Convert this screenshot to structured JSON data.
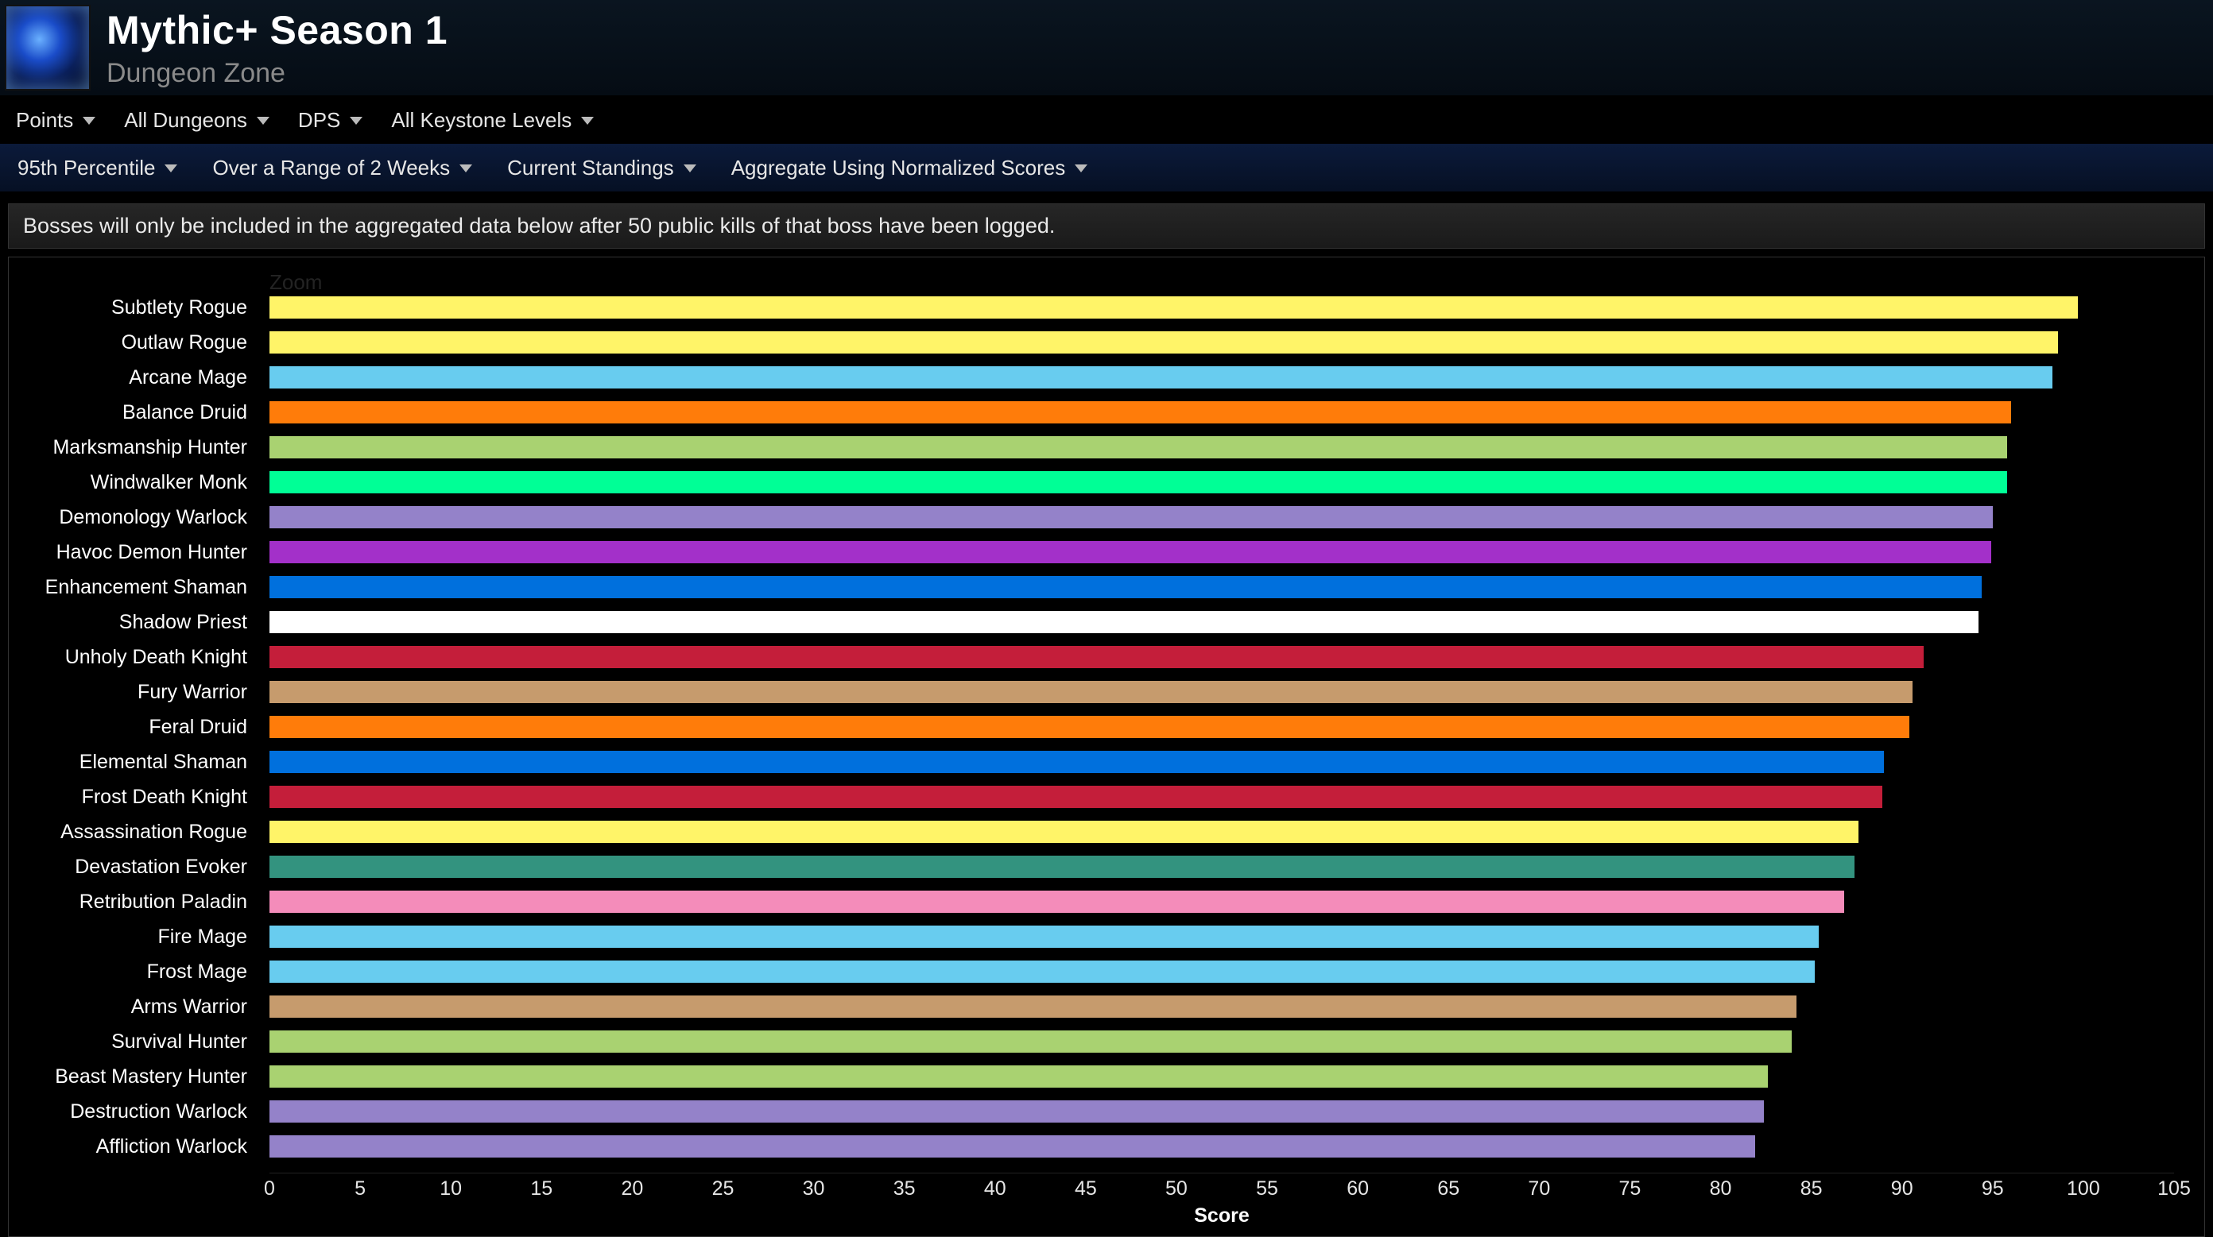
{
  "header": {
    "title": "Mythic+ Season 1",
    "subtitle": "Dungeon Zone"
  },
  "toolbar_primary": [
    {
      "label": "Points"
    },
    {
      "label": "All Dungeons"
    },
    {
      "label": "DPS"
    },
    {
      "label": "All Keystone Levels"
    }
  ],
  "toolbar_secondary": [
    {
      "label": "95th Percentile"
    },
    {
      "label": "Over a Range of 2 Weeks"
    },
    {
      "label": "Current Standings"
    },
    {
      "label": "Aggregate Using Normalized Scores"
    }
  ],
  "note": "Bosses will only be included in the aggregated data below after 50 public kills of that boss have been logged.",
  "chart_ui": {
    "zoom_label": "Zoom"
  },
  "chart_data": {
    "type": "bar",
    "orientation": "horizontal",
    "title": "",
    "xlabel": "Score",
    "ylabel": "",
    "xlim": [
      0,
      105
    ],
    "xticks": [
      0,
      5,
      10,
      15,
      20,
      25,
      30,
      35,
      40,
      45,
      50,
      55,
      60,
      65,
      70,
      75,
      80,
      85,
      90,
      95,
      100,
      105
    ],
    "series": [
      {
        "name": "Subtlety Rogue",
        "value": 99.7,
        "color": "#FFF468"
      },
      {
        "name": "Outlaw Rogue",
        "value": 98.6,
        "color": "#FFF468"
      },
      {
        "name": "Arcane Mage",
        "value": 98.3,
        "color": "#68CCEF"
      },
      {
        "name": "Balance Druid",
        "value": 96.0,
        "color": "#FF7C0A"
      },
      {
        "name": "Marksmanship Hunter",
        "value": 95.8,
        "color": "#A9D271"
      },
      {
        "name": "Windwalker Monk",
        "value": 95.8,
        "color": "#00FF96"
      },
      {
        "name": "Demonology Warlock",
        "value": 95.0,
        "color": "#9482C9"
      },
      {
        "name": "Havoc Demon Hunter",
        "value": 94.9,
        "color": "#A330C9"
      },
      {
        "name": "Enhancement Shaman",
        "value": 94.4,
        "color": "#0070DD"
      },
      {
        "name": "Shadow Priest",
        "value": 94.2,
        "color": "#FFFFFF"
      },
      {
        "name": "Unholy Death Knight",
        "value": 91.2,
        "color": "#C41E3A"
      },
      {
        "name": "Fury Warrior",
        "value": 90.6,
        "color": "#C69B6D"
      },
      {
        "name": "Feral Druid",
        "value": 90.4,
        "color": "#FF7C0A"
      },
      {
        "name": "Elemental Shaman",
        "value": 89.0,
        "color": "#0070DD"
      },
      {
        "name": "Frost Death Knight",
        "value": 88.9,
        "color": "#C41E3A"
      },
      {
        "name": "Assassination Rogue",
        "value": 87.6,
        "color": "#FFF468"
      },
      {
        "name": "Devastation Evoker",
        "value": 87.4,
        "color": "#33937F"
      },
      {
        "name": "Retribution Paladin",
        "value": 86.8,
        "color": "#F48CBA"
      },
      {
        "name": "Fire Mage",
        "value": 85.4,
        "color": "#68CCEF"
      },
      {
        "name": "Frost Mage",
        "value": 85.2,
        "color": "#68CCEF"
      },
      {
        "name": "Arms Warrior",
        "value": 84.2,
        "color": "#C69B6D"
      },
      {
        "name": "Survival Hunter",
        "value": 83.9,
        "color": "#A9D271"
      },
      {
        "name": "Beast Mastery Hunter",
        "value": 82.6,
        "color": "#A9D271"
      },
      {
        "name": "Destruction Warlock",
        "value": 82.4,
        "color": "#9482C9"
      },
      {
        "name": "Affliction Warlock",
        "value": 81.9,
        "color": "#9482C9"
      }
    ]
  }
}
